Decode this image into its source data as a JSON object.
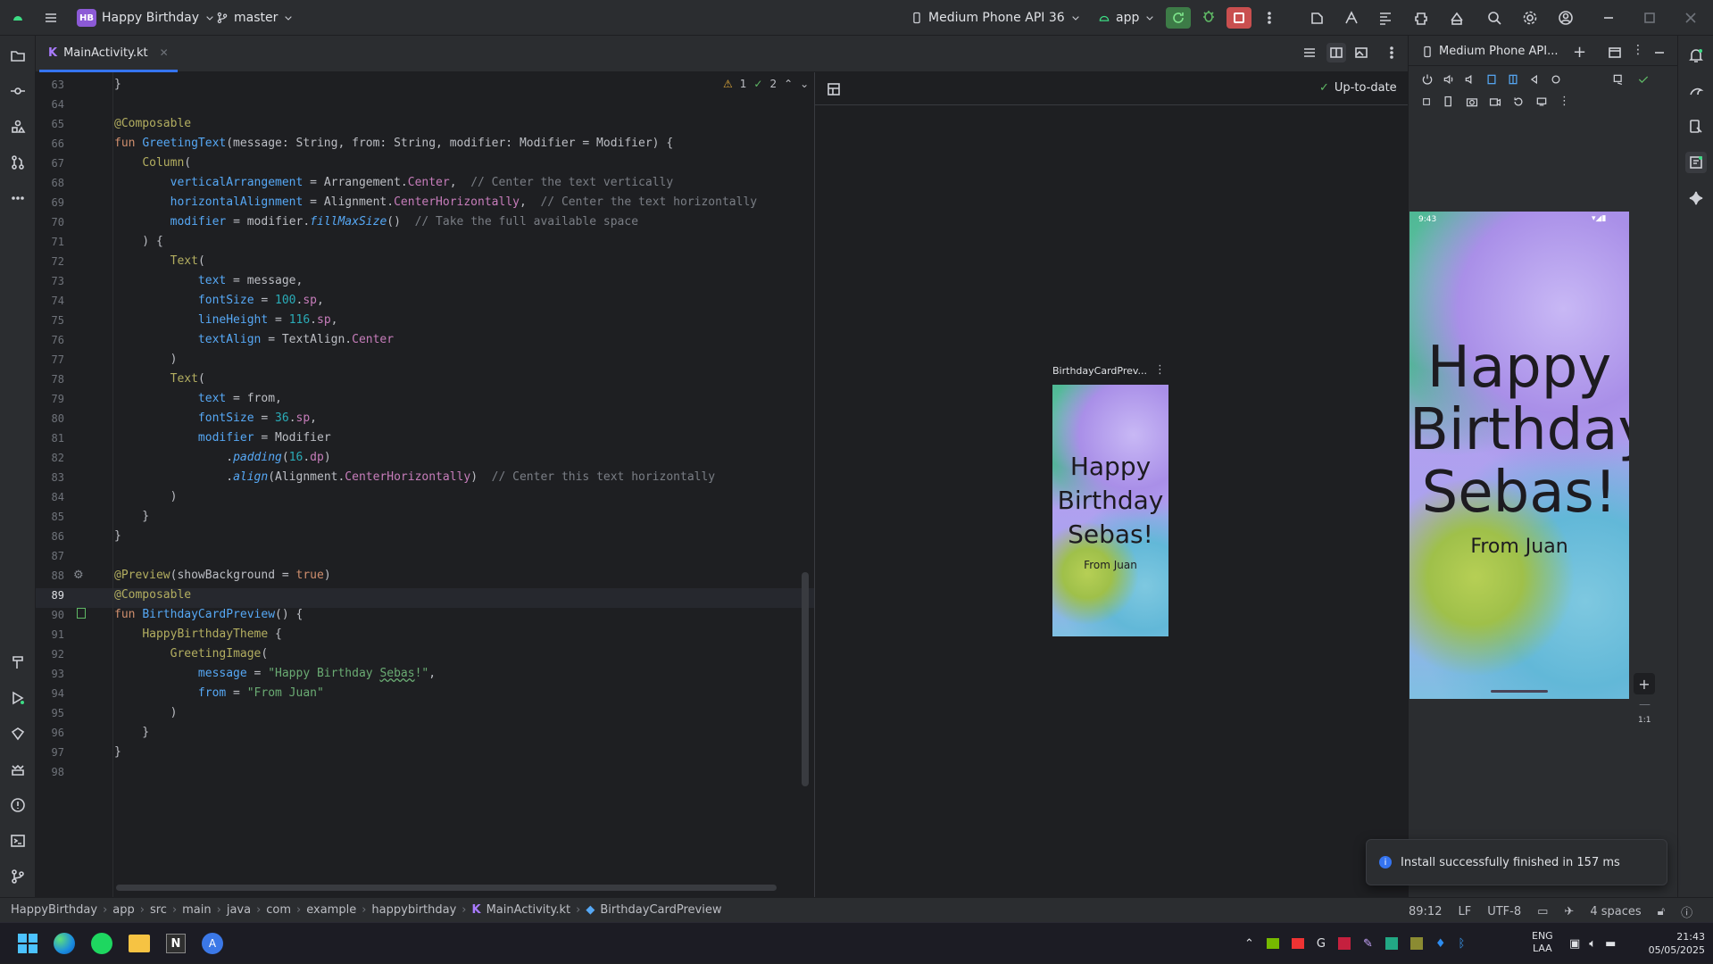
{
  "titlebar": {
    "project_badge": "HB",
    "project_name": "Happy Birthday",
    "branch": "master",
    "device": "Medium Phone API 36",
    "run_config": "app"
  },
  "tab": {
    "file": "MainActivity.kt"
  },
  "editor": {
    "warnings": "1",
    "checks": "2",
    "line_numbers": [
      "63",
      "64",
      "65",
      "66",
      "67",
      "68",
      "69",
      "70",
      "71",
      "72",
      "73",
      "74",
      "75",
      "76",
      "77",
      "78",
      "79",
      "80",
      "81",
      "82",
      "83",
      "84",
      "85",
      "86",
      "87",
      "88",
      "89",
      "90",
      "91",
      "92",
      "93",
      "94",
      "95",
      "96",
      "97",
      "98"
    ]
  },
  "preview": {
    "status": "Up-to-date",
    "card_label": "BirthdayCardPrev...",
    "card_title": "Happy Birthday Sebas!",
    "card_from": "From Juan"
  },
  "device_panel": {
    "tab_title": "Medium Phone API...",
    "clock": "9:43",
    "greeting": "Happy Birthday Sebas!",
    "from": "From Juan",
    "zoom": "1:1"
  },
  "toast": {
    "message": "Install successfully finished in 157 ms"
  },
  "statusbar": {
    "breadcrumbs": [
      "HappyBirthday",
      "app",
      "src",
      "main",
      "java",
      "com",
      "example",
      "happybirthday",
      "MainActivity.kt",
      "BirthdayCardPreview"
    ],
    "position": "89:12",
    "line_sep": "LF",
    "encoding": "UTF-8",
    "indent": "4 spaces"
  },
  "taskbar": {
    "lang": "ENG",
    "layout": "LAA",
    "time": "21:43",
    "date": "05/05/2025"
  }
}
